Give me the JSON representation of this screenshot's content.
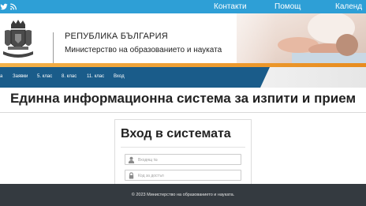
{
  "topbar": {
    "links": [
      "Контакти",
      "Помощ",
      "Календ"
    ],
    "bg": "#2e9fd6"
  },
  "header": {
    "republic": "РЕПУБЛИКА БЪЛГАРИЯ",
    "ministry": "Министерство на образованието и науката"
  },
  "nav": {
    "items": [
      "Заявки",
      "5. клас",
      "8. клас",
      "11. клас",
      "Вход"
    ],
    "bg": "#1a5c8a"
  },
  "main": {
    "title": "Единна информационна система за изпити и прием"
  },
  "login": {
    "title": "Вход в системата",
    "username_placeholder": "Входящ №",
    "password_placeholder": "Код за достъп"
  },
  "footer": {
    "copyright": "© 2023 Министерство на образованието и науката."
  },
  "colors": {
    "accent_orange": "#e88c1f",
    "footer_bg": "#343a40"
  }
}
